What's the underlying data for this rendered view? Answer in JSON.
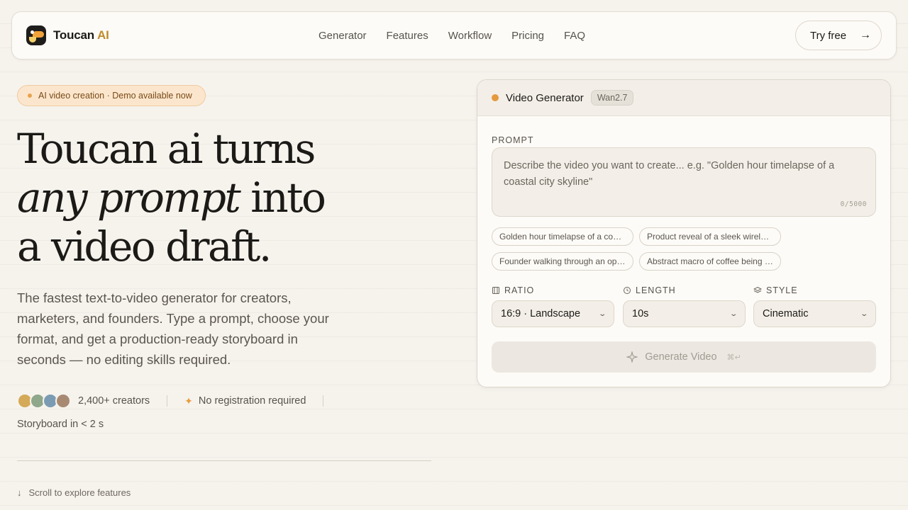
{
  "header": {
    "brand": "Toucan",
    "brand_accent": "AI",
    "nav": [
      "Generator",
      "Features",
      "Workflow",
      "Pricing",
      "FAQ"
    ],
    "cta": "Try free"
  },
  "hero": {
    "pill": "AI video creation · Demo available now",
    "headline_line1": "Toucan ai turns",
    "headline_italic": "any prompt",
    "headline_line2_rest": "into",
    "headline_line3": "a video draft.",
    "subtext": "The fastest text-to-video generator for creators, marketers, and founders. Type a prompt, choose your format, and get a production-ready storyboard in seconds — no editing skills required.",
    "creators": "2,400+ creators",
    "no_registration": "No registration required",
    "storyboard": "Storyboard in < 2 s",
    "scroll": "Scroll to explore features"
  },
  "generator": {
    "title": "Video Generator",
    "model": "Wan2.7",
    "prompt_label": "PROMPT",
    "prompt_placeholder": "Describe the video you want to create... e.g. \"Golden hour timelapse of a coastal city skyline\"",
    "counter": "0/5000",
    "suggestions": [
      "Golden hour timelapse of a coastal city skyline",
      "Product reveal of a sleek wireless headphone",
      "Founder walking through an open-plan office",
      "Abstract macro of coffee being poured"
    ],
    "ratio_label": "RATIO",
    "ratio_value": "16:9 · Landscape",
    "length_label": "LENGTH",
    "length_value": "10s",
    "style_label": "STYLE",
    "style_value": "Cinematic",
    "generate_label": "Generate Video",
    "shortcut": "⌘↵"
  },
  "colors": {
    "background": "#f6f3ed",
    "accent": "#e59a3e",
    "brand_accent": "#c08a2c",
    "avatars": [
      "#d4a957",
      "#8fa78a",
      "#7b9bb3",
      "#a88a73"
    ]
  }
}
